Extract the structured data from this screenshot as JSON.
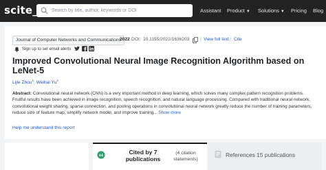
{
  "nav": {
    "logo": "scite_",
    "search_placeholder": "Search by title, author, keywords or DOI",
    "links": [
      {
        "label": "Assistant"
      },
      {
        "label": "Product",
        "has_dropdown": true
      },
      {
        "label": "Solutions",
        "has_dropdown": true
      },
      {
        "label": "Pricing"
      },
      {
        "label": "Blog"
      }
    ]
  },
  "paper": {
    "journal": "Journal of Computer Networks and Communications",
    "year": "2022",
    "doi_label": "DOI:",
    "doi": "10.1155/2022/1636203",
    "view_full_text": "View full text",
    "cite": "Cite",
    "alert_label": "Sign up to set email alerts",
    "title": "Improved Convolutional Neural Image Recognition Algorithm based on LeNet-5",
    "authors": [
      "Lijie Zhou",
      "Weihai Yu"
    ],
    "author_sups": [
      "1",
      "2"
    ],
    "abstract_label": "Abstract:",
    "abstract_text": "Convolutional neural network (CNN) is a very important method in deep learning, which solves many complex pattern recognition problems. Fruitful results have been achieved in image recognition, speech recognition, and natural language processing. Compared with traditional neural network, convolutional weight sharing, sparse connection, and pooling operations in convolutional neural network greatly reduce the number of training parameters, reduce size of feature map, simplify network model, and improve training...",
    "show_more": "Show more",
    "help_link": "Help me understand this report"
  },
  "tabs": {
    "cited_label": "Cited by 7 publications",
    "cited_sub": "(4 citation statements)",
    "refs_label": "References 15 publications"
  },
  "colors": {
    "nav_bg": "#232323",
    "link": "#1a56c9",
    "citation_icon": "#2fa36b"
  }
}
